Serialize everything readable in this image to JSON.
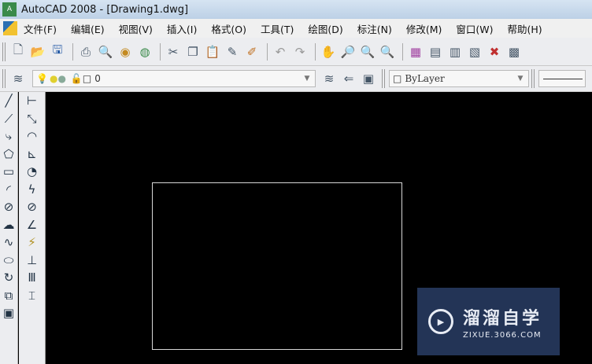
{
  "title": "AutoCAD 2008 - [Drawing1.dwg]",
  "menu": [
    "文件(F)",
    "编辑(E)",
    "视图(V)",
    "插入(I)",
    "格式(O)",
    "工具(T)",
    "绘图(D)",
    "标注(N)",
    "修改(M)",
    "窗口(W)",
    "帮助(H)"
  ],
  "layer": {
    "value": "0"
  },
  "color": {
    "value": "ByLayer"
  },
  "watermark": {
    "name": "溜溜自学",
    "url": "ZIXUE.3066.COM"
  }
}
